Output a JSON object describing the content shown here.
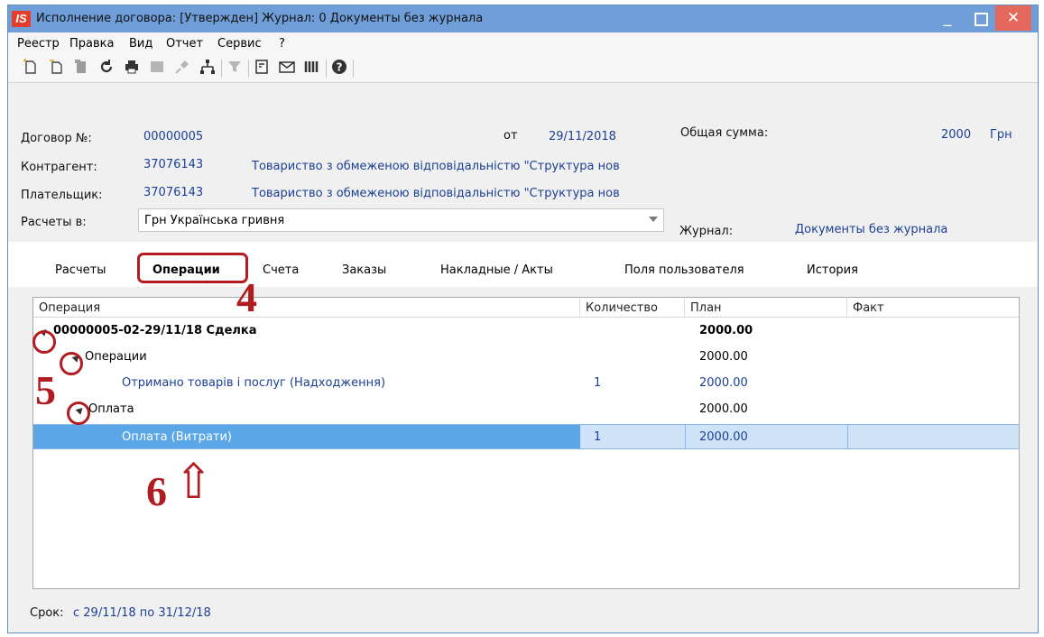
{
  "window": {
    "logo": "IS",
    "title": "Исполнение договора: [Утвержден] Журнал: 0 Документы без журнала",
    "minimize": "_",
    "close": "✕"
  },
  "menu": [
    "Реестр",
    "Правка",
    "Вид",
    "Отчет",
    "Сервис",
    "?"
  ],
  "toolbar_icons": [
    "new-doc-icon",
    "copy-doc-icon",
    "paste-icon",
    "refresh-icon",
    "print-icon",
    "note-icon",
    "pin-icon",
    "hierarchy-icon",
    "filter-icon",
    "form-icon",
    "mail-icon",
    "columns-icon",
    "help-icon"
  ],
  "header": {
    "contract_label": "Договор №:",
    "contract_number": "00000005",
    "from_label": "от",
    "date": "29/11/2018",
    "total_label": "Общая сумма:",
    "total_value": "2000",
    "currency": "Грн",
    "counterparty_label": "Контрагент:",
    "counterparty_code": "37076143",
    "counterparty_name": "Товариство з обмеженою відповідальністю \"Структура нов",
    "payer_label": "Плательщик:",
    "payer_code": "37076143",
    "payer_name": "Товариство з обмеженою відповідальністю \"Структура нов",
    "settlements_label": "Расчеты в:",
    "settlements_value": "Грн Українська гривня",
    "journal_label": "Журнал:",
    "journal_value": "Документы без журнала"
  },
  "tabs": [
    "Расчеты",
    "Операции",
    "Счета",
    "Заказы",
    "Накладные / Акты",
    "Поля пользователя",
    "История"
  ],
  "grid": {
    "columns": [
      "Операция",
      "Количество",
      "План",
      "Факт"
    ],
    "rows": [
      {
        "name": "00000005-02-29/11/18 Сделка",
        "qty": "",
        "plan": "2000.00",
        "fact": ""
      },
      {
        "name": "Операции",
        "qty": "",
        "plan": "2000.00",
        "fact": ""
      },
      {
        "name": "Отримано товарів і послуг (Надходження)",
        "qty": "1",
        "plan": "2000.00",
        "fact": ""
      },
      {
        "name": "Оплата",
        "qty": "",
        "plan": "2000.00",
        "fact": ""
      },
      {
        "name": "Оплата (Витрати)",
        "qty": "1",
        "plan": "2000.00",
        "fact": ""
      }
    ]
  },
  "footer": {
    "term_label": "Срок:",
    "term_value": "с 29/11/18 по 31/12/18"
  },
  "annotations": {
    "n4": "4",
    "n5": "5",
    "n6": "6",
    "arrow": "⇧"
  },
  "colors": {
    "accent_red": "#b01c20",
    "titlebar": "#6f9ed8",
    "selection": "#5aa6e6",
    "link_blue": "#1c3f94"
  }
}
